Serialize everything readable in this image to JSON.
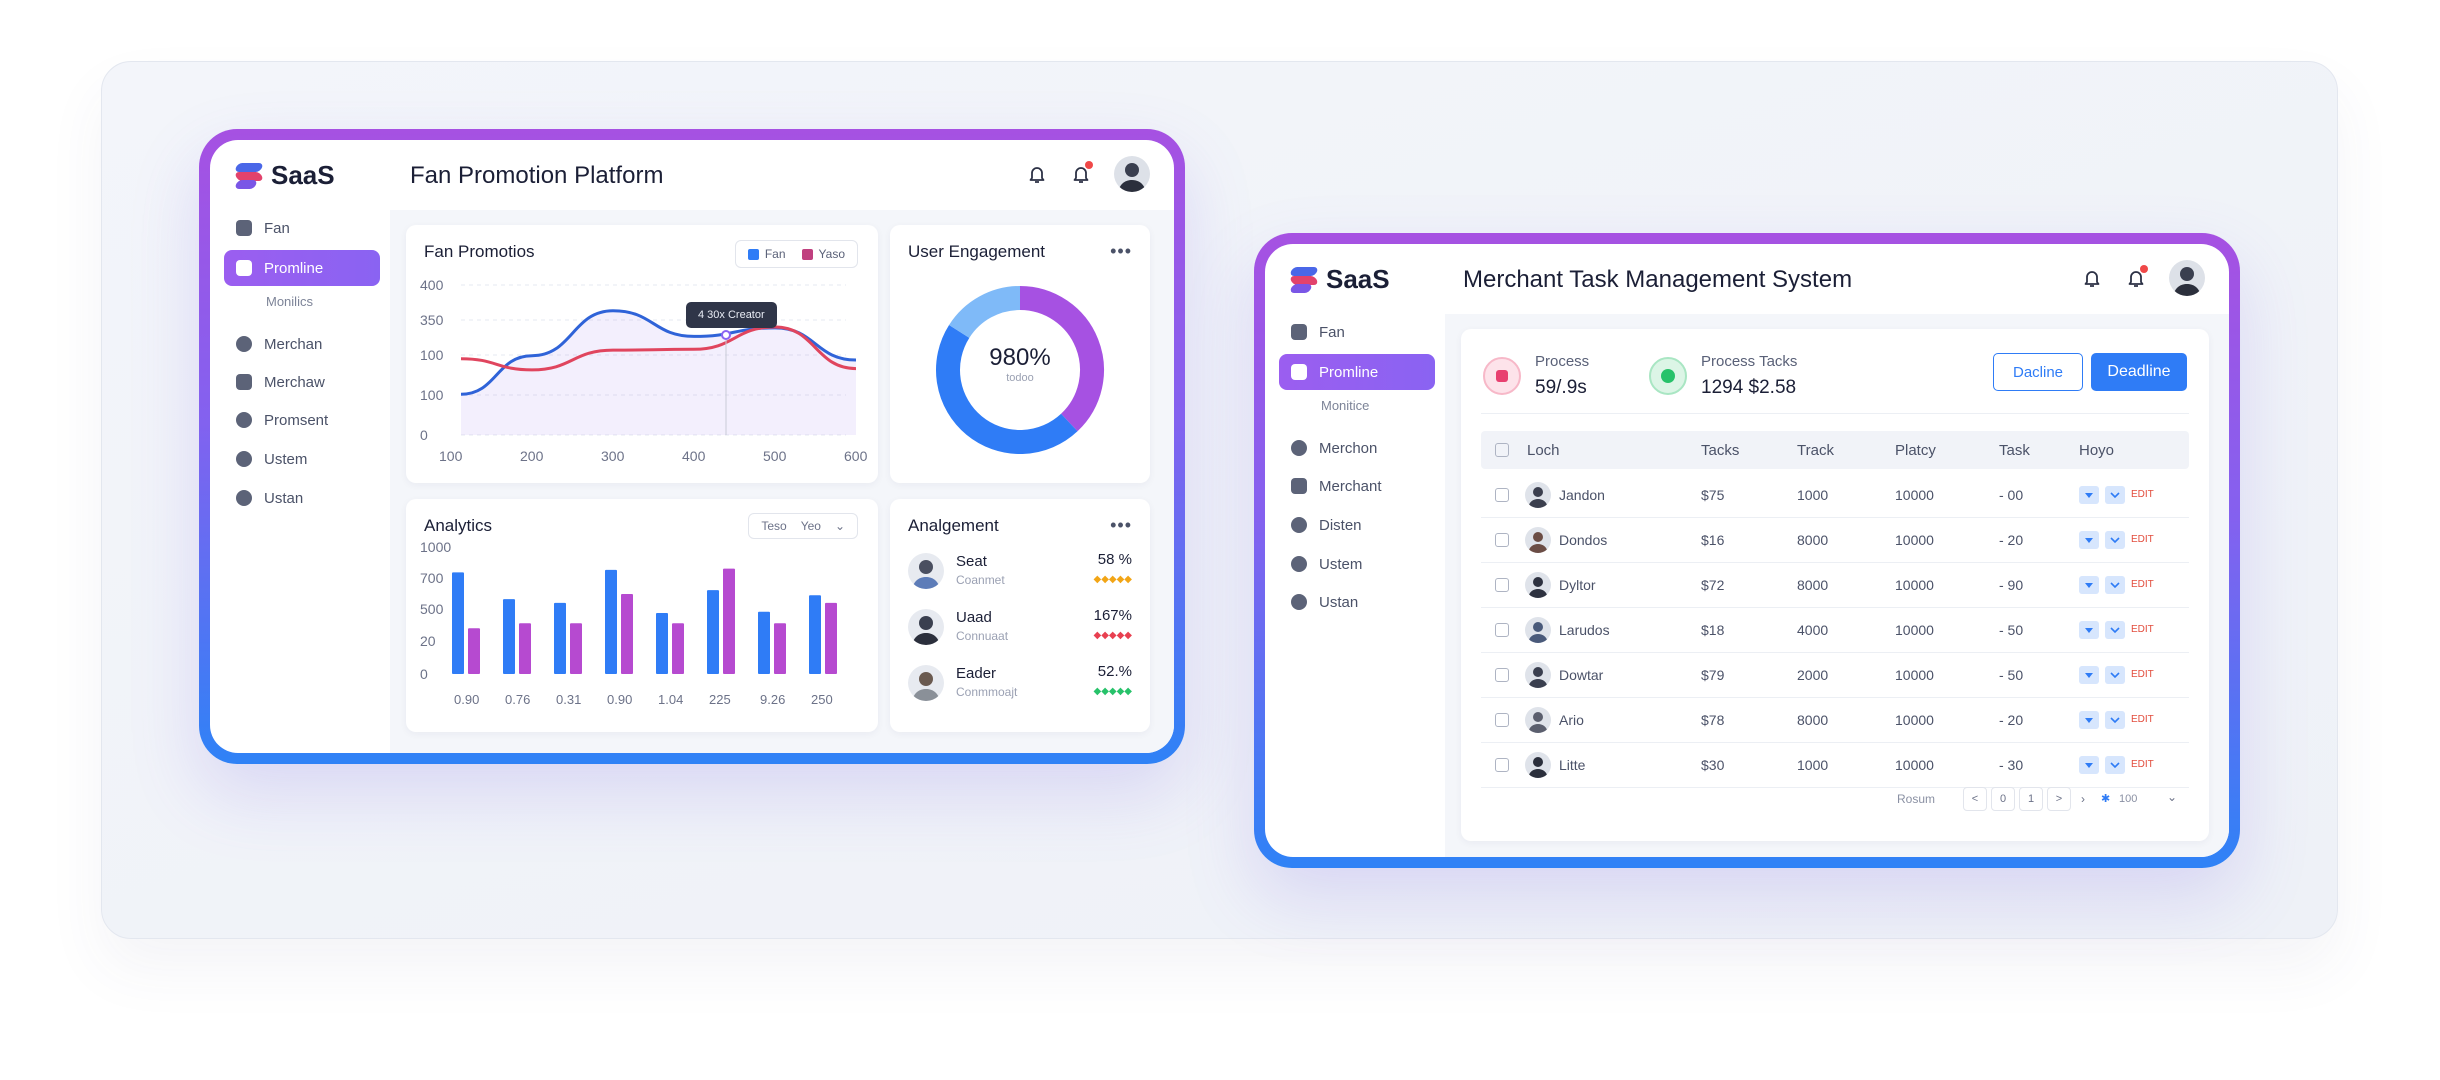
{
  "brand": {
    "name": "SaaS",
    "colors": {
      "accent_purple": "#9b5ef0",
      "accent_blue": "#2f7cf6",
      "magenta": "#b64ad0",
      "red": "#e24c3c"
    }
  },
  "dashboard1": {
    "title": "Fan Promotion Platform",
    "sidebar": {
      "items": [
        {
          "label": "Fan",
          "icon": "home-icon"
        },
        {
          "label": "Promline",
          "icon": "lock-icon",
          "active": true
        },
        {
          "label": "Monilics",
          "sub": true
        },
        {
          "label": "Merchan",
          "icon": "shield-icon"
        },
        {
          "label": "Merchaw",
          "icon": "list-icon"
        },
        {
          "label": "Promsent",
          "icon": "plus-circle-icon"
        },
        {
          "label": "Ustem",
          "icon": "eye-icon"
        },
        {
          "label": "Ustan",
          "icon": "gear-icon"
        }
      ]
    },
    "line_panel": {
      "title": "Fan Promotios",
      "legend": [
        "Fan",
        "Yaso"
      ],
      "tooltip": "4 30x Creator"
    },
    "engagement_panel": {
      "title": "User Engagement",
      "value": "980%",
      "sub": "todoo"
    },
    "analytics_panel": {
      "title": "Analytics",
      "select": [
        "Teso",
        "Yeo"
      ]
    },
    "alignment_panel": {
      "title": "Analgement",
      "rows": [
        {
          "name": "Seat",
          "sub": "Coanmet",
          "pct": "58 %",
          "stars_color": "#f2a516"
        },
        {
          "name": "Uaad",
          "sub": "Connuaat",
          "pct": "167%",
          "stars_color": "#e84050"
        },
        {
          "name": "Eader",
          "sub": "Conmmoajt",
          "pct": "52.%",
          "stars_color": "#27c26a"
        }
      ]
    }
  },
  "chart_data": [
    {
      "type": "line",
      "title": "Fan Promotios",
      "x": [
        100,
        200,
        300,
        400,
        500,
        600
      ],
      "xtick_labels": [
        "100",
        "200",
        "300",
        "400",
        "500",
        "600"
      ],
      "ytick_labels": [
        "400",
        "350",
        "100",
        "100",
        "0"
      ],
      "series": [
        {
          "name": "Fan",
          "color": "#2f63d8",
          "values": [
            95,
            185,
            290,
            230,
            250,
            175
          ]
        },
        {
          "name": "Yaso",
          "color": "#e0455e",
          "values": [
            178,
            152,
            198,
            200,
            252,
            155
          ]
        }
      ],
      "legend_placement": "top-right",
      "grid": true
    },
    {
      "type": "pie",
      "title": "User Engagement",
      "center_label": "980%",
      "slices": [
        {
          "color": "#a651e2",
          "value": 38
        },
        {
          "color": "#2f7cf6",
          "value": 46
        },
        {
          "color": "#7fbaf8",
          "value": 16
        }
      ]
    },
    {
      "type": "bar",
      "title": "Analytics",
      "categories": [
        "0.90",
        "0.76",
        "0.31",
        "0.90",
        "1.04",
        "225",
        "9.26",
        "250"
      ],
      "ytick_labels": [
        "1000",
        "700",
        "500",
        "20",
        "0"
      ],
      "series": [
        {
          "color": "#2f7cf6",
          "values": [
            800,
            590,
            560,
            820,
            480,
            660,
            490,
            620
          ]
        },
        {
          "color": "#b64ad0",
          "values": [
            360,
            400,
            400,
            630,
            400,
            830,
            400,
            560
          ]
        }
      ],
      "ylim": [
        0,
        1000
      ]
    }
  ],
  "dashboard2": {
    "title": "Merchant Task Management System",
    "sidebar": {
      "items": [
        {
          "label": "Fan",
          "icon": "home-icon"
        },
        {
          "label": "Promline",
          "icon": "lock-icon",
          "active": true
        },
        {
          "label": "Monitice",
          "sub": true
        },
        {
          "label": "Merchon",
          "icon": "shield-icon"
        },
        {
          "label": "Merchant",
          "icon": "list-icon"
        },
        {
          "label": "Disten",
          "icon": "plus-circle-icon"
        },
        {
          "label": "Ustem",
          "icon": "eye-icon"
        },
        {
          "label": "Ustan",
          "icon": "gear-icon"
        }
      ]
    },
    "stats": [
      {
        "label": "Process",
        "value": "59/.9s",
        "color": "#e84070"
      },
      {
        "label": "Process Tacks",
        "value": "1294 $2.58",
        "color": "#27c26a"
      }
    ],
    "buttons": {
      "outline": "Dacline",
      "primary": "Deadline"
    },
    "table": {
      "headers": [
        "Loch",
        "Tacks",
        "Track",
        "Platcy",
        "Task",
        "Hoyo"
      ],
      "action_text": "EDIT",
      "rows": [
        {
          "name": "Jandon",
          "tacks": "$75",
          "track": "1000",
          "platcy": "10000",
          "task": "- 00"
        },
        {
          "name": "Dondos",
          "tacks": "$16",
          "track": "8000",
          "platcy": "10000",
          "task": "- 20"
        },
        {
          "name": "Dyltor",
          "tacks": "$72",
          "track": "8000",
          "platcy": "10000",
          "task": "- 90"
        },
        {
          "name": "Larudos",
          "tacks": "$18",
          "track": "4000",
          "platcy": "10000",
          "task": "- 50"
        },
        {
          "name": "Dowtar",
          "tacks": "$79",
          "track": "2000",
          "platcy": "10000",
          "task": "- 50"
        },
        {
          "name": "Ario",
          "tacks": "$78",
          "track": "8000",
          "platcy": "10000",
          "task": "- 20"
        },
        {
          "name": "Litte",
          "tacks": "$30",
          "track": "1000",
          "platcy": "10000",
          "task": "- 30"
        }
      ]
    },
    "pager": {
      "label": "Rosum",
      "pages": [
        "<",
        "0",
        "1",
        ">"
      ],
      "per_page": "100"
    }
  }
}
